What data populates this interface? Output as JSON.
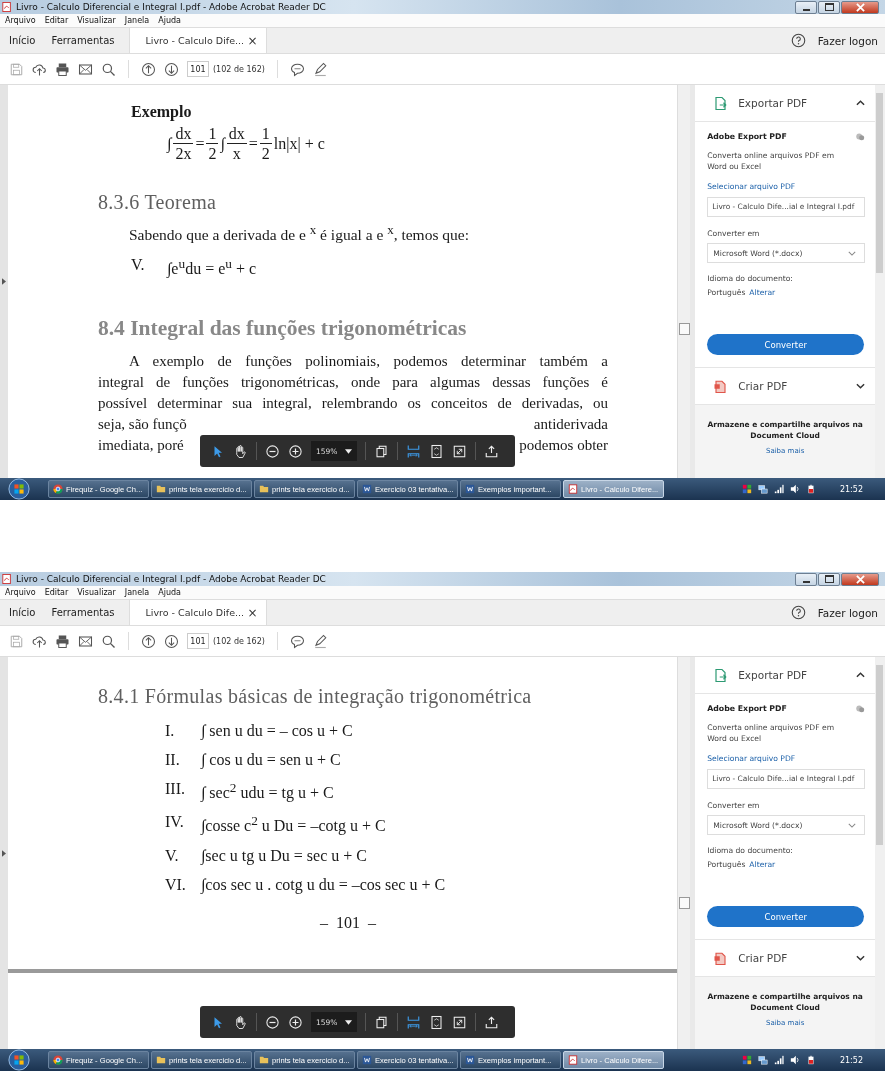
{
  "screens": [
    {
      "title": "Livro - Calculo Diferencial e Integral I.pdf - Adobe Acrobat Reader DC",
      "menu": [
        "Arquivo",
        "Editar",
        "Visualizar",
        "Janela",
        "Ajuda"
      ],
      "nav": [
        "Início",
        "Ferramentas"
      ],
      "doc_tab": {
        "label": "Livro - Calculo Dife...",
        "close": "×"
      },
      "login": "Fazer logon",
      "page_field": "101",
      "page_count": "(102 de 162)",
      "blocks": [
        {
          "kind": "label",
          "text": "Exemplo"
        },
        {
          "kind": "fraction_formula",
          "parts": [
            {
              "kind": "sym",
              "text": "∫"
            },
            {
              "kind": "frac",
              "num": "dx",
              "den": "2x"
            },
            {
              "kind": "sym",
              "text": "="
            },
            {
              "kind": "frac",
              "num": "1",
              "den": "2"
            },
            {
              "kind": "sym",
              "text": "∫"
            },
            {
              "kind": "frac",
              "num": "dx",
              "den": "x"
            },
            {
              "kind": "sym",
              "text": "="
            },
            {
              "kind": "frac",
              "num": "1",
              "den": "2"
            },
            {
              "kind": "sym",
              "text": "ln|x| + c"
            }
          ]
        },
        {
          "kind": "heading",
          "text": "8.3.6 Teorema"
        },
        {
          "kind": "text",
          "text": "Sabendo que a derivada de e $^{x}$ é igual a e $^{x}$, temos que:"
        },
        {
          "kind": "numbered",
          "number": "V.",
          "formula": "∫e$^{u}$du = e$^{u}$ + c"
        },
        {
          "kind": "section",
          "text": "8.4 Integral das funções trigonométricas"
        },
        {
          "kind": "paragraph",
          "lines": [
            {
              "left": "A exemplo de funções polinomiais, podemos determinar também a"
            },
            {
              "left": "integral de funções trigonométricas, onde para algumas dessas funções é"
            },
            {
              "left": "possível determinar sua integral, relembrando os conceitos de derivadas, ou"
            },
            {
              "left": "seja, são funçõ",
              "right": "antiderivada"
            },
            {
              "left": "imediata, poré",
              "right": "podemos obter"
            }
          ]
        }
      ],
      "float_zoom": "159%",
      "panel": {
        "sections": [
          {
            "label": "Exportar PDF",
            "expanded": true,
            "body": {
              "title": "Adobe Export PDF",
              "desc": "Converta online arquivos PDF em Word ou Excel",
              "select_link": "Selecionar arquivo PDF",
              "file": "Livro - Calculo Dife...ial e Integral I.pdf",
              "convert_label": "Converter em",
              "format": "Microsoft Word (*.docx)",
              "lang_label": "Idioma do documento:",
              "lang": "Português",
              "change_link": "Alterar",
              "button": "Converter"
            }
          },
          {
            "label": "Criar PDF",
            "expanded": false
          }
        ],
        "footer": {
          "text": "Armazene e compartilhe arquivos na Document Cloud",
          "link": "Saiba mais"
        }
      },
      "taskbar": {
        "items": [
          {
            "kind": "browser",
            "label": "Firequiz - Google Ch...",
            "selected": false
          },
          {
            "kind": "folder",
            "label": "prints tela exercicio d...",
            "selected": false
          },
          {
            "kind": "folder",
            "label": "prints tela exercicio d...",
            "selected": false
          },
          {
            "kind": "word",
            "label": "Exercicio 03 tentativa...",
            "selected": false
          },
          {
            "kind": "word",
            "label": "Exemplos important...",
            "selected": false
          },
          {
            "kind": "pdf",
            "label": "Livro - Calculo Difere...",
            "selected": true
          }
        ],
        "clock": "21:52"
      }
    },
    {
      "title": "Livro - Calculo Diferencial e Integral I.pdf - Adobe Acrobat Reader DC",
      "menu": [
        "Arquivo",
        "Editar",
        "Visualizar",
        "Janela",
        "Ajuda"
      ],
      "nav": [
        "Início",
        "Ferramentas"
      ],
      "doc_tab": {
        "label": "Livro - Calculo Dife...",
        "close": "×"
      },
      "login": "Fazer logon",
      "page_field": "101",
      "page_count": "(102 de 162)",
      "blocks": [
        {
          "kind": "heading",
          "text": "8.4.1 Fórmulas básicas de integração trigonométrica"
        },
        {
          "kind": "numbered",
          "number": "I.",
          "formula": "∫ sen u du = – cos u + C"
        },
        {
          "kind": "numbered",
          "number": "II.",
          "formula": "∫ cos u du = sen u + C"
        },
        {
          "kind": "numbered",
          "number": "III.",
          "formula": "∫ sec$^{2}$ udu = tg u + C"
        },
        {
          "kind": "numbered",
          "number": "IV.",
          "formula": "∫cosse c$^{2}$ u Du = –cotg u + C"
        },
        {
          "kind": "numbered",
          "number": "V.",
          "formula": "∫sec u tg u Du = sec u + C"
        },
        {
          "kind": "numbered",
          "number": "VI.",
          "formula": "∫cos sec u . cotg u du = –cos sec u + C"
        },
        {
          "kind": "page_number",
          "text": "–  101  –"
        },
        {
          "kind": "page_break"
        }
      ],
      "float_zoom": "159%",
      "panel": {
        "sections": [
          {
            "label": "Exportar PDF",
            "expanded": true,
            "body": {
              "title": "Adobe Export PDF",
              "desc": "Converta online arquivos PDF em Word ou Excel",
              "select_link": "Selecionar arquivo PDF",
              "file": "Livro - Calculo Dife...ial e Integral I.pdf",
              "convert_label": "Converter em",
              "format": "Microsoft Word (*.docx)",
              "lang_label": "Idioma do documento:",
              "lang": "Português",
              "change_link": "Alterar",
              "button": "Converter"
            }
          },
          {
            "label": "Criar PDF",
            "expanded": false
          }
        ],
        "footer": {
          "text": "Armazene e compartilhe arquivos na Document Cloud",
          "link": "Saiba mais"
        }
      },
      "taskbar": {
        "items": [
          {
            "kind": "browser",
            "label": "Firequiz - Google Ch...",
            "selected": false
          },
          {
            "kind": "folder",
            "label": "prints tela exercicio d...",
            "selected": false
          },
          {
            "kind": "folder",
            "label": "prints tela exercicio d...",
            "selected": false
          },
          {
            "kind": "word",
            "label": "Exercicio 03 tentativa...",
            "selected": false
          },
          {
            "kind": "word",
            "label": "Exemplos important...",
            "selected": false
          },
          {
            "kind": "pdf",
            "label": "Livro - Calculo Difere...",
            "selected": true
          }
        ],
        "clock": "21:52"
      }
    }
  ]
}
